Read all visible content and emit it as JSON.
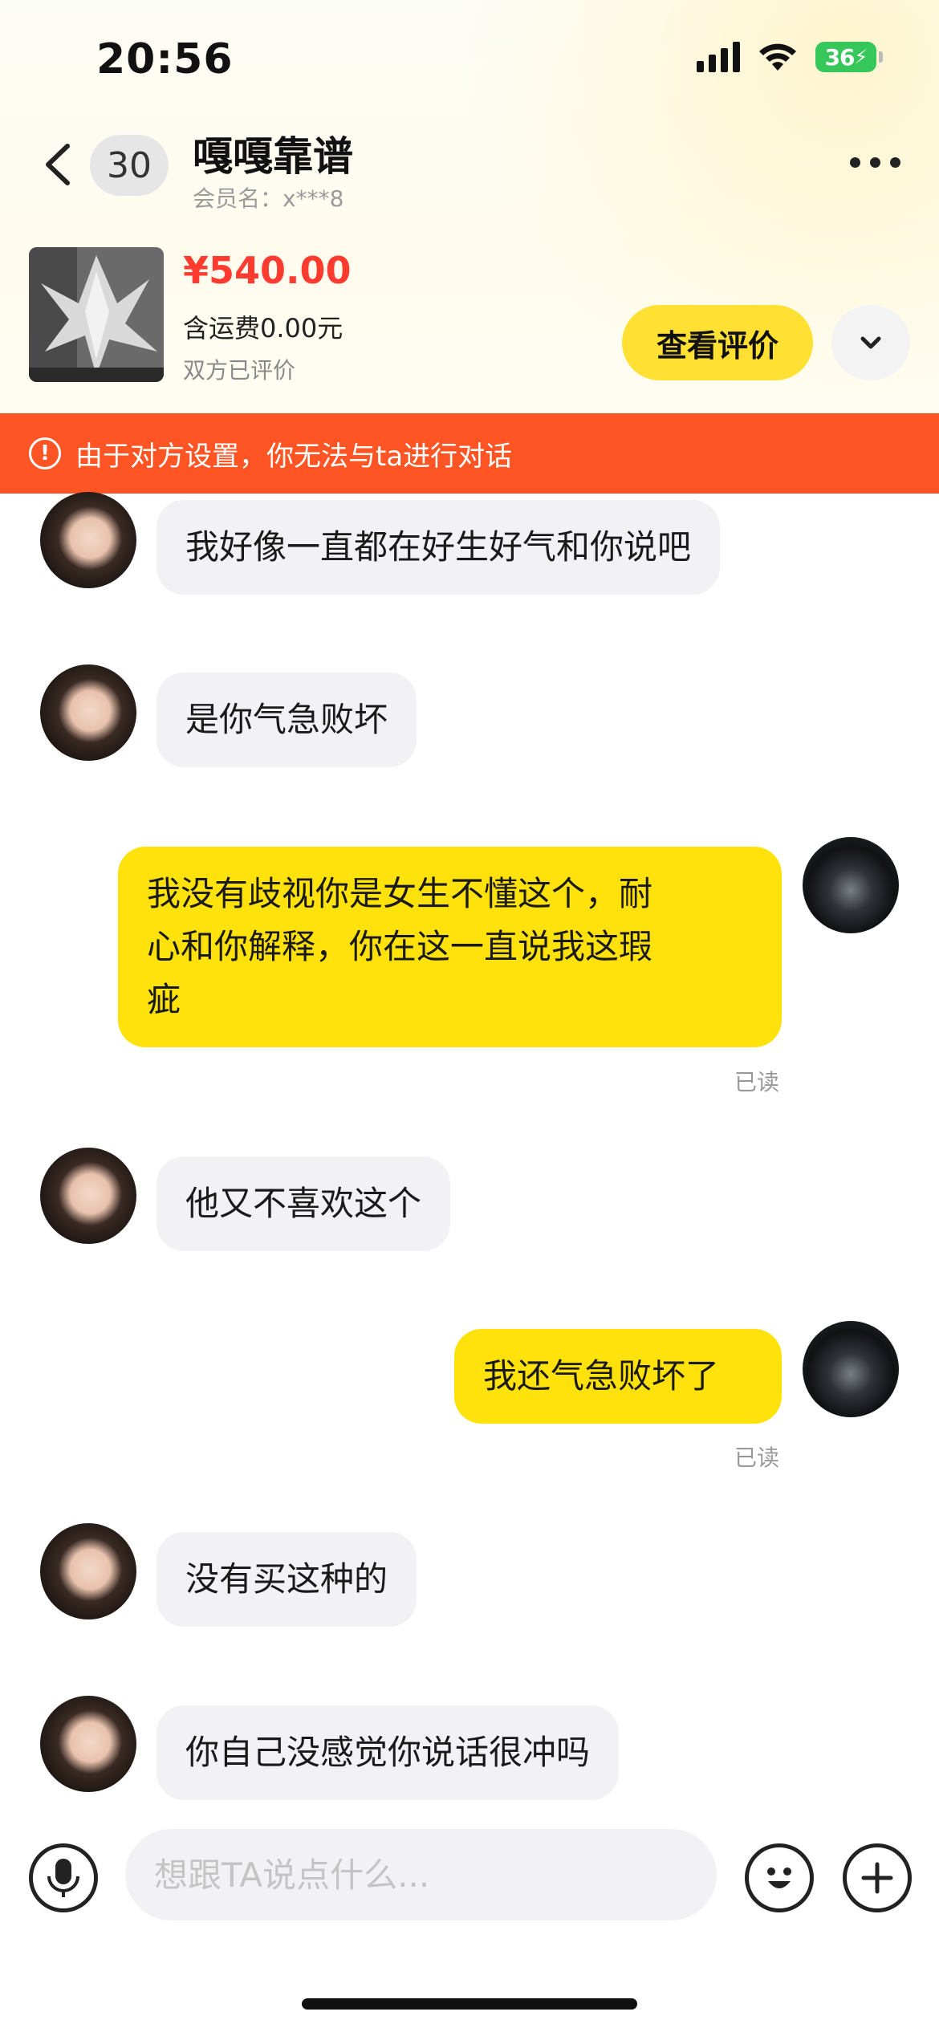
{
  "status_bar": {
    "time": "20:56",
    "battery": "36",
    "icons": [
      "signal-icon",
      "wifi-icon",
      "battery-charging-icon"
    ]
  },
  "nav": {
    "back_icon": "chevron-left-icon",
    "unread_count": "30",
    "contact_name": "嘎嘎靠谱",
    "member_label": "会员名：x***8",
    "more_icon": "more-dots-icon"
  },
  "product": {
    "price": "¥540.00",
    "shipping": "含运费0.00元",
    "review_status": "双方已评价",
    "view_review_label": "查看评价",
    "expand_icon": "chevron-down-icon"
  },
  "banner": {
    "icon": "warning-icon",
    "text": "由于对方设置，你无法与ta进行对话",
    "color": "#ff5423"
  },
  "messages": [
    {
      "sender": "them",
      "lines": [
        "我好像一直都在好生好气和你说吧"
      ]
    },
    {
      "sender": "them",
      "lines": [
        "是你气急败坏"
      ]
    },
    {
      "sender": "me",
      "lines": [
        "我没有歧视你是女生不懂这个，耐",
        "心和你解释，你在这一直说我这瑕",
        "疵"
      ],
      "status": "已读"
    },
    {
      "sender": "them",
      "lines": [
        "他又不喜欢这个"
      ]
    },
    {
      "sender": "me",
      "lines": [
        "我还气急败坏了"
      ],
      "status": "已读"
    },
    {
      "sender": "them",
      "lines": [
        "没有买这种的"
      ]
    },
    {
      "sender": "them",
      "lines": [
        "你自己没感觉你说话很冲吗"
      ]
    }
  ],
  "input_bar": {
    "mic_icon": "microphone-icon",
    "placeholder": "想跟TA说点什么...",
    "value": "",
    "emoji_icon": "emoji-icon",
    "plus_icon": "plus-icon"
  },
  "colors": {
    "accent_yellow": "#ffe033",
    "my_bubble": "#ffe20c",
    "their_bubble": "#f2f2f4",
    "price_red": "#ff3b30"
  }
}
